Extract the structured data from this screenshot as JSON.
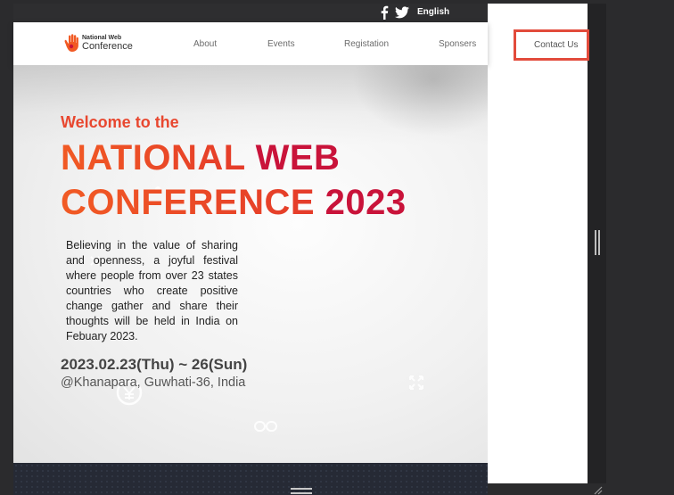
{
  "topbar": {
    "social": [
      "facebook-icon",
      "twitter-icon"
    ],
    "language": "English"
  },
  "nav": {
    "logo": {
      "line1": "National Web",
      "line2": "Conference"
    },
    "items": [
      "About",
      "Events",
      "Registation",
      "Sponsers",
      "Contact Us"
    ]
  },
  "hero": {
    "welcome": "Welcome to the",
    "title_line1_a": "NATIONAL ",
    "title_line1_b": "WEB",
    "title_line2_a": "CONFERENCE ",
    "title_line2_b": "2023",
    "description": "Believing in the value of sharing and openness, a joyful festival where people from over 23 states countries who create positive change gather and share their thoughts will be held in India on Febuary 2023.",
    "dates": "2023.02.23(Thu) ~ 26(Sun)",
    "venue": "@Khanapara, Guwhati-36, India"
  },
  "colors": {
    "accent_orange": "#f15a24",
    "accent_crimson": "#c9133a",
    "contact_border": "#e24b3b",
    "topbar_bg": "#2e2e30"
  }
}
